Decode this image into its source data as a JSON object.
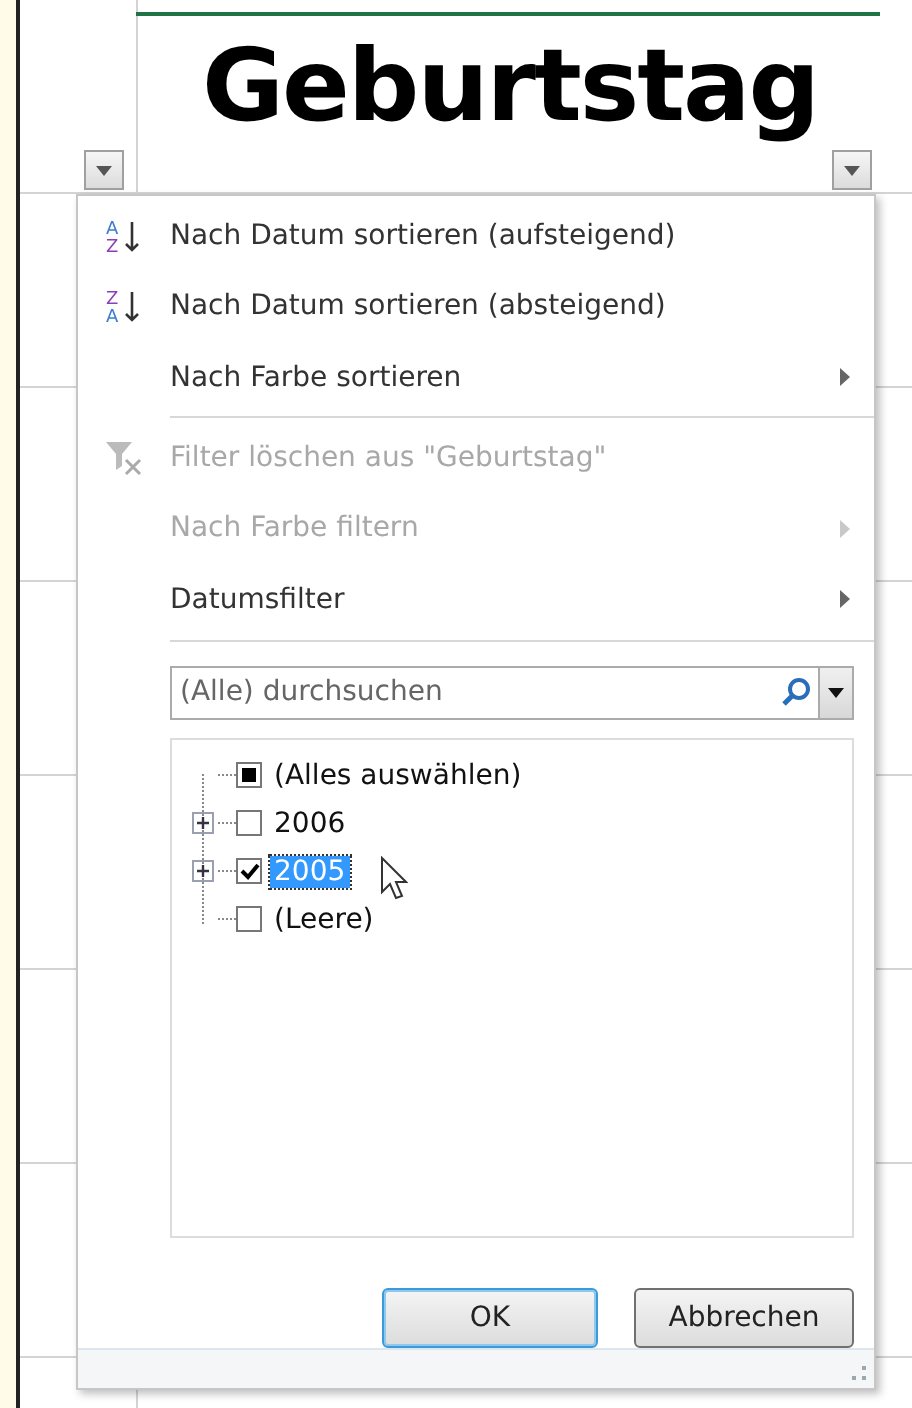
{
  "header_cell": {
    "text": "Geburtstag"
  },
  "menu": {
    "items": [
      {
        "kind": "sort-asc",
        "icon_letters": [
          "A",
          "Z"
        ],
        "label": "Nach Datum sortieren (aufsteigend)",
        "disabled": false,
        "submenu": false
      },
      {
        "kind": "sort-desc",
        "icon_letters": [
          "Z",
          "A"
        ],
        "label": "Nach Datum sortieren (absteigend)",
        "disabled": false,
        "submenu": false
      },
      {
        "kind": "plain",
        "label": "Nach Farbe sortieren",
        "disabled": false,
        "submenu": true
      },
      {
        "kind": "separator"
      },
      {
        "kind": "clear-filter",
        "label": "Filter löschen aus \"Geburtstag\"",
        "disabled": true,
        "submenu": false
      },
      {
        "kind": "plain",
        "label": "Nach Farbe filtern",
        "disabled": true,
        "submenu": true
      },
      {
        "kind": "plain",
        "label": "Datumsfilter",
        "disabled": false,
        "submenu": true
      },
      {
        "kind": "separator"
      }
    ]
  },
  "search": {
    "placeholder": "(Alle) durchsuchen"
  },
  "tree": [
    {
      "label": "(Alles auswählen)",
      "checked": false,
      "indeterminate": true,
      "expandable": false,
      "selected": false
    },
    {
      "label": "2006",
      "checked": false,
      "indeterminate": false,
      "expandable": true,
      "selected": false
    },
    {
      "label": "2005",
      "checked": true,
      "indeterminate": false,
      "expandable": true,
      "selected": true
    },
    {
      "label": "(Leere)",
      "checked": false,
      "indeterminate": false,
      "expandable": false,
      "selected": false
    }
  ],
  "buttons": [
    {
      "label": "OK",
      "default": true
    },
    {
      "label": "Abbrechen",
      "default": false
    }
  ]
}
